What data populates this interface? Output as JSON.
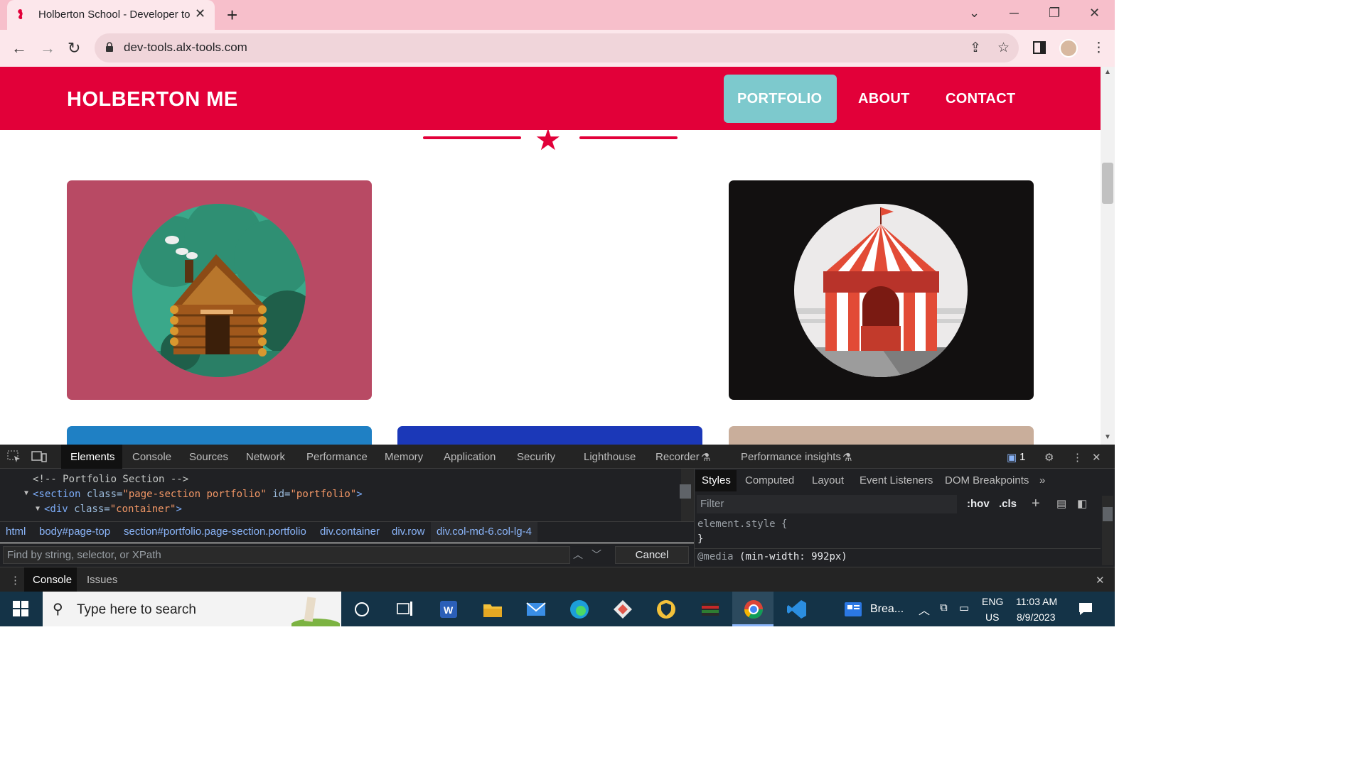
{
  "browser": {
    "tab_title": "Holberton School - Developer to",
    "url": "dev-tools.alx-tools.com"
  },
  "site": {
    "brand": "HOLBERTON ME",
    "nav": [
      "PORTFOLIO",
      "ABOUT",
      "CONTACT"
    ],
    "colors": {
      "primary": "#e20039",
      "accent": "#7dc9cd"
    },
    "cards_row1": [
      {
        "bg": "#b84a64",
        "image": "log-cabin-illustration"
      },
      {
        "bg": "#ffffff",
        "image": "none"
      },
      {
        "bg": "#121010",
        "image": "circus-tent-illustration"
      }
    ],
    "cards_row2": [
      "#1f80c4",
      "#1b38b8",
      "#c9ae9b"
    ]
  },
  "devtools": {
    "tabs": [
      "Elements",
      "Console",
      "Sources",
      "Network",
      "Performance",
      "Memory",
      "Application",
      "Security",
      "Lighthouse",
      "Recorder",
      "Performance insights"
    ],
    "issues_badge": "1",
    "code": {
      "comment": "<!-- Portfolio Section -->",
      "section_tag": "<section",
      "section_attr1": " class=",
      "section_val1": "\"page-section portfolio\"",
      "section_attr2": " id=",
      "section_val2": "\"portfolio\"",
      "section_end": ">",
      "div_tag": "<div",
      "div_attr": " class=",
      "div_val": "\"container\"",
      "div_end": ">"
    },
    "breadcrumbs": [
      "html",
      "body#page-top",
      "section#portfolio.page-section.portfolio",
      "div.container",
      "div.row",
      "div.col-md-6.col-lg-4"
    ],
    "find_placeholder": "Find by string, selector, or XPath",
    "cancel_label": "Cancel",
    "styles_tabs": [
      "Styles",
      "Computed",
      "Layout",
      "Event Listeners",
      "DOM Breakpoints"
    ],
    "filter_placeholder": "Filter",
    "hov": ":hov",
    "cls": ".cls",
    "element_style": "element.style {",
    "close_brace": "}",
    "media_kw": "@media",
    "media_query": "(min-width: 992px)",
    "drawer_tabs": [
      "Console",
      "Issues"
    ]
  },
  "taskbar": {
    "search_placeholder": "Type here to search",
    "app_label": "Brea...",
    "lang": "ENG",
    "region": "US",
    "time": "11:03 AM",
    "date": "8/9/2023"
  }
}
